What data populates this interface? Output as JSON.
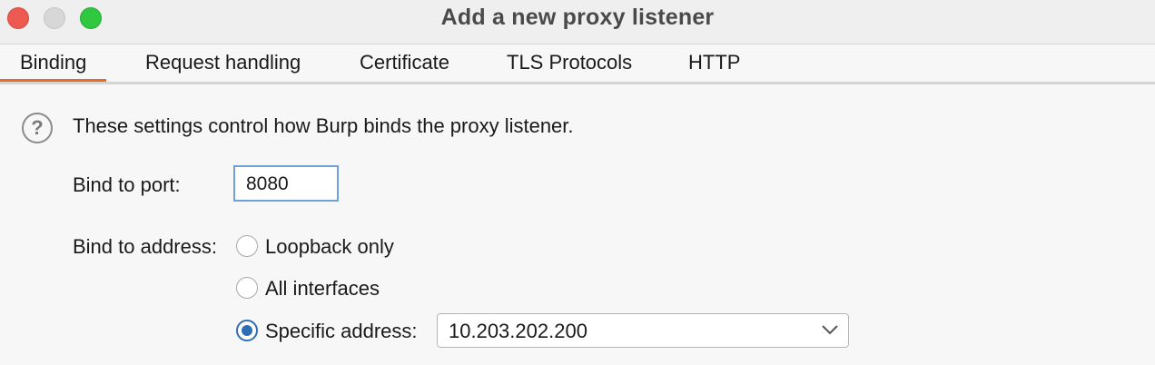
{
  "window": {
    "title": "Add a new proxy listener"
  },
  "tabs": [
    {
      "label": "Binding",
      "active": true
    },
    {
      "label": "Request handling",
      "active": false
    },
    {
      "label": "Certificate",
      "active": false
    },
    {
      "label": "TLS Protocols",
      "active": false
    },
    {
      "label": "HTTP",
      "active": false
    }
  ],
  "binding": {
    "description": "These settings control how Burp binds the proxy listener.",
    "port_label": "Bind to port:",
    "port_value": "8080",
    "address_label": "Bind to address:",
    "options": [
      {
        "label": "Loopback only",
        "selected": false
      },
      {
        "label": "All interfaces",
        "selected": false
      },
      {
        "label": "Specific address:",
        "selected": true
      }
    ],
    "specific_address": "10.203.202.200"
  },
  "colors": {
    "accent_tab": "#e8692a",
    "radio_selected": "#2f6db2",
    "focus_border": "#6fa0d8"
  }
}
